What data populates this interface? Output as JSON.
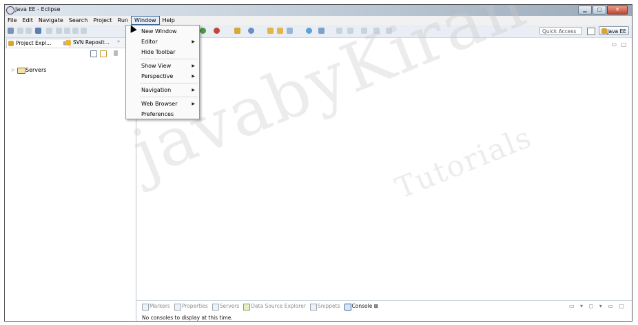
{
  "window": {
    "title": "Java EE - Eclipse",
    "minimize": "▁",
    "maximize": "□",
    "close": "✕"
  },
  "menubar": [
    "File",
    "Edit",
    "Navigate",
    "Search",
    "Project",
    "Run",
    "Window",
    "Help"
  ],
  "toolbar": {
    "quick_access": "Quick Access",
    "perspective_label": "Java EE"
  },
  "left_panel": {
    "tabs": [
      {
        "label": "Project Expl...",
        "close": "⊠"
      },
      {
        "label": "SVN Reposit..."
      }
    ],
    "tab_menu": "»",
    "tree": [
      {
        "label": "Servers",
        "expander": "▷"
      }
    ]
  },
  "editor_controls": {
    "minimize": "▭",
    "maximize": "□"
  },
  "window_menu": {
    "items": [
      {
        "label": "New Window",
        "submenu": ""
      },
      {
        "label": "Editor",
        "submenu": "▶"
      },
      {
        "label": "Hide Toolbar",
        "submenu": ""
      },
      {
        "label": "Show View",
        "submenu": "▶"
      },
      {
        "label": "Perspective",
        "submenu": "▶"
      },
      {
        "label": "Navigation",
        "submenu": "▶"
      },
      {
        "label": "Web Browser",
        "submenu": "▶"
      },
      {
        "label": "Preferences",
        "submenu": ""
      }
    ]
  },
  "bottom_panel": {
    "tabs": [
      "Markers",
      "Properties",
      "Servers",
      "Data Source Explorer",
      "Snippets",
      "Console"
    ],
    "active_tab": "Console",
    "active_close": "⊠",
    "controls": "▭ ▾ ◻ ▾ ▭ □",
    "message": "No consoles to display at this time."
  },
  "watermark": {
    "line1": "javabyKiran",
    "line2": "Tutorials"
  },
  "colors": {
    "accent": "#3f6a9c",
    "titlebar": "#cfd9e4",
    "toolbar": "#e9eef4",
    "close": "#c4452c"
  }
}
